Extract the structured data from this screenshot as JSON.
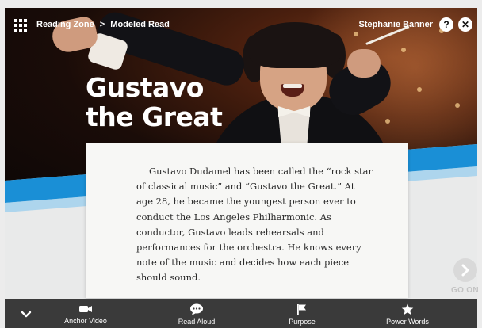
{
  "header": {
    "breadcrumb": [
      "Reading Zone",
      "Modeled Read"
    ],
    "separator": ">",
    "user_name": "Stephanie Banner",
    "help_label": "?",
    "close_label": "✕"
  },
  "hero": {
    "title_line1": "Gustavo",
    "title_line2": "the Great"
  },
  "passage": {
    "text": "Gustavo Dudamel has been called the “rock star of classical music” and “Gustavo the Great.” At age 28, he became the youngest person ever to conduct the Los Angeles Philharmonic. As conductor, Gustavo leads rehearsals and performances for the orchestra. He knows every note of the music and decides how each piece should sound."
  },
  "go_on": {
    "label": "GO ON",
    "icon": "chevron-right-icon"
  },
  "toolbar": {
    "items": [
      {
        "label": "Anchor Video",
        "icon": "video-camera-icon"
      },
      {
        "label": "Read Aloud",
        "icon": "speech-bubble-icon"
      },
      {
        "label": "Purpose",
        "icon": "flag-icon"
      },
      {
        "label": "Power Words",
        "icon": "star-icon"
      }
    ]
  },
  "colors": {
    "toolbar_bg": "#3a3a3a",
    "wave_blue": "#1a8fd6",
    "wave_light": "#7cc3ee",
    "card_bg": "#f7f7f5"
  }
}
